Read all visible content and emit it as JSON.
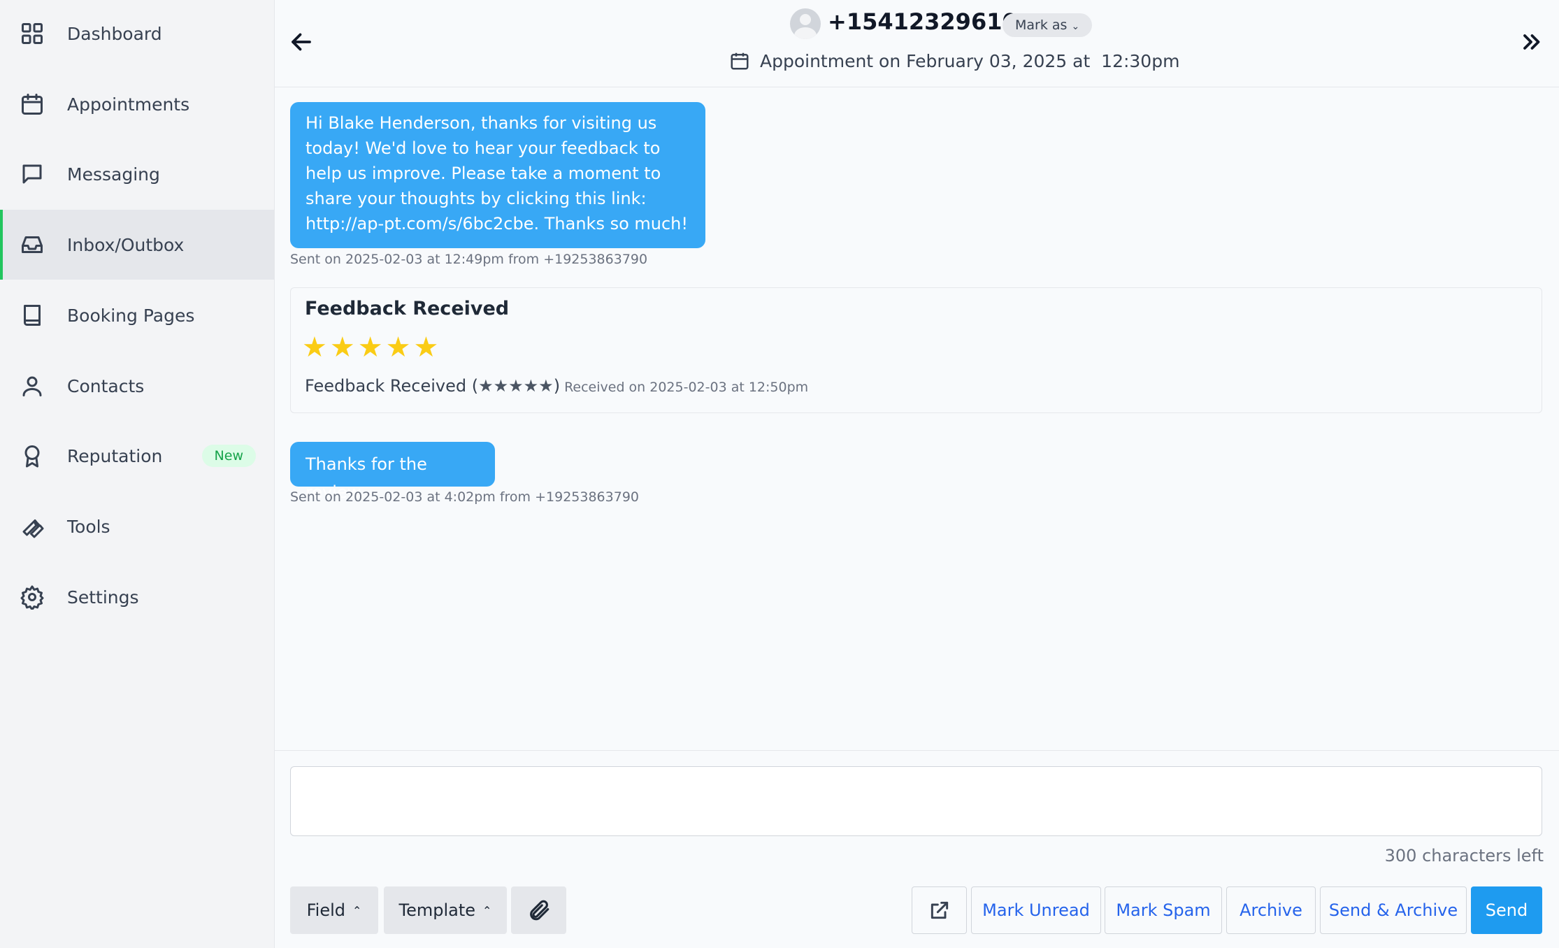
{
  "sidebar": {
    "items": [
      {
        "label": "Dashboard",
        "icon": "grid-icon"
      },
      {
        "label": "Appointments",
        "icon": "calendar-icon"
      },
      {
        "label": "Messaging",
        "icon": "message-icon"
      },
      {
        "label": "Inbox/Outbox",
        "icon": "inbox-icon",
        "active": true
      },
      {
        "label": "Booking Pages",
        "icon": "book-icon"
      },
      {
        "label": "Contacts",
        "icon": "user-icon"
      },
      {
        "label": "Reputation",
        "icon": "award-icon",
        "badge": "New"
      },
      {
        "label": "Tools",
        "icon": "wrench-icon"
      },
      {
        "label": "Settings",
        "icon": "gear-icon"
      }
    ]
  },
  "header": {
    "phone": "+15412329610",
    "mark_as": "Mark as",
    "appointment": "Appointment on February 03, 2025 at  12:30pm"
  },
  "messages": {
    "first": {
      "text": "Hi Blake Henderson, thanks for visiting us today! We'd love to hear your feedback to help us improve. Please take a moment to share your thoughts by clicking this link: http://ap-pt.com/s/6bc2cbe. Thanks so much!",
      "meta": "Sent on 2025-02-03 at 12:49pm from +19253863790"
    },
    "feedback": {
      "title": "Feedback Received",
      "rating": 5,
      "stars": "★★★★★",
      "line_prefix": "Feedback Received (",
      "line_stars": "★★★★★",
      "line_suffix": ")",
      "received": "Received on 2025-02-03 at 12:50pm"
    },
    "second": {
      "text": "Thanks for the review.",
      "meta": "Sent on 2025-02-03 at 4:02pm from +19253863790"
    }
  },
  "composer": {
    "placeholder": "",
    "chars_left": "300 characters left",
    "field_label": "Field",
    "template_label": "Template",
    "mark_unread": "Mark Unread",
    "mark_spam": "Mark Spam",
    "archive": "Archive",
    "send_archive": "Send & Archive",
    "send": "Send"
  },
  "colors": {
    "accent": "#22c55e",
    "bubble": "#38a8f5",
    "primary": "#1e9bf0",
    "star": "#facc15"
  }
}
